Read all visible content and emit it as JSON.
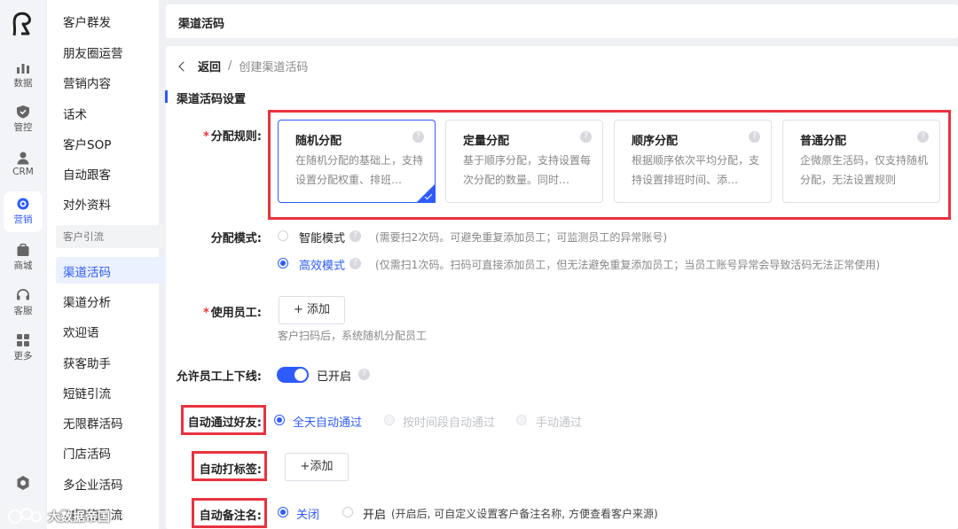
{
  "rail": {
    "items": [
      {
        "label": "数据",
        "icon": "bar-chart-icon"
      },
      {
        "label": "管控",
        "icon": "shield-icon"
      },
      {
        "label": "CRM",
        "icon": "user-icon"
      },
      {
        "label": "营销",
        "icon": "target-icon"
      },
      {
        "label": "商城",
        "icon": "shop-icon"
      },
      {
        "label": "客服",
        "icon": "headset-icon"
      },
      {
        "label": "更多",
        "icon": "grid-icon"
      }
    ]
  },
  "submenu": {
    "items_top": [
      "客户群发",
      "朋友圈运营",
      "营销内容",
      "话术",
      "客户SOP",
      "自动跟客",
      "对外资料"
    ],
    "group": "客户引流",
    "items_group": [
      "渠道活码",
      "渠道分析",
      "欢迎语",
      "获客助手",
      "短链引流",
      "无限群活码",
      "门店活码",
      "多企业活码",
      "AI智能引流"
    ]
  },
  "header": {
    "title": "渠道活码"
  },
  "breadcrumb": {
    "back": "返回",
    "sep": "/",
    "current": "创建渠道活码"
  },
  "section": {
    "title": "渠道活码设置"
  },
  "assign_rule": {
    "label": "分配规则:",
    "cards": [
      {
        "title": "随机分配",
        "desc": "在随机分配的基础上，支持设置分配权重、排班…"
      },
      {
        "title": "定量分配",
        "desc": "基于顺序分配，支持设置每次分配的数量。同时…"
      },
      {
        "title": "顺序分配",
        "desc": "根据顺序依次平均分配，支持设置排班时间、添…"
      },
      {
        "title": "普通分配",
        "desc": "企微原生活码，仅支持随机分配，无法设置规则"
      }
    ]
  },
  "assign_mode": {
    "label": "分配模式:",
    "smart": "智能模式",
    "smart_hint": "(需要扫2次码。可避免重复添加员工；可监测员工的异常账号)",
    "efficient": "高效模式",
    "efficient_hint": "(仅需扫1次码。扫码可直接添加员工，但无法避免重复添加员工；当员工账号异常会导致活码无法正常使用)"
  },
  "staff": {
    "label": "使用员工:",
    "add": "+ 添加",
    "hint": "客户扫码后，系统随机分配员工"
  },
  "online": {
    "label": "允许员工上下线:",
    "state": "已开启"
  },
  "auto_friend": {
    "label": "自动通过好友:",
    "opt1": "全天自动通过",
    "opt2": "按时间段自动通过",
    "opt3": "手动通过"
  },
  "auto_tag": {
    "label": "自动打标签:",
    "add": "+添加"
  },
  "auto_remark": {
    "label": "自动备注名:",
    "off": "关闭",
    "on": "开启",
    "on_hint": "(开启后, 可自定义设置客户备注名称, 方便查看客户来源)"
  },
  "watermark": {
    "text": "大数据帝国"
  }
}
